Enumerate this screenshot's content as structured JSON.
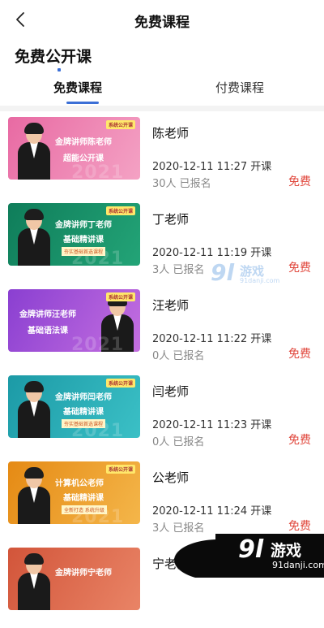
{
  "nav": {
    "title": "免费课程"
  },
  "section": {
    "title": "免费公开课"
  },
  "tabs": [
    {
      "label": "免费课程",
      "active": true
    },
    {
      "label": "付费课程",
      "active": false
    }
  ],
  "courses": [
    {
      "teacher": "陈老师",
      "time": "2020-12-11 11:27 开课",
      "enrolled": "30人 已报名",
      "price": "免费",
      "thumb": {
        "badge": "系统公开课",
        "line1": "金牌讲师陈老师",
        "line2": "超能公开课",
        "line3": "",
        "year": "2021",
        "bg": "#e86aa3",
        "bg2": "#f4a2c4"
      }
    },
    {
      "teacher": "丁老师",
      "time": "2020-12-11 11:19 开课",
      "enrolled": "3人 已报名",
      "price": "免费",
      "thumb": {
        "badge": "系统公开课",
        "line1": "金牌讲师丁老师",
        "line2": "基础精讲课",
        "line3": "夯实基础首选课程",
        "year": "2021",
        "bg": "#0f7d5a",
        "bg2": "#23a477"
      }
    },
    {
      "teacher": "汪老师",
      "time": "2020-12-11 11:22 开课",
      "enrolled": "0人 已报名",
      "price": "免费",
      "thumb": {
        "badge": "系统公开课",
        "line1": "金牌讲师汪老师",
        "line2": "基础语法课",
        "line3": "",
        "year": "2021",
        "bg": "#8a3fd1",
        "bg2": "#c46fe0"
      }
    },
    {
      "teacher": "闫老师",
      "time": "2020-12-11 11:23 开课",
      "enrolled": "0人 已报名",
      "price": "免费",
      "thumb": {
        "badge": "系统公开课",
        "line1": "金牌讲师闫老师",
        "line2": "基础精讲课",
        "line3": "夯实基础首选课程",
        "year": "2021",
        "bg": "#1c9aa6",
        "bg2": "#3bc0c6"
      }
    },
    {
      "teacher": "公老师",
      "time": "2020-12-11 11:24 开课",
      "enrolled": "3人 已报名",
      "price": "免费",
      "thumb": {
        "badge": "系统公开课",
        "line1": "计算机公老师",
        "line2": "基础精讲课",
        "line3": "全新打造 系统升级",
        "year": "2021",
        "bg": "#e58a14",
        "bg2": "#f4b64a"
      }
    },
    {
      "teacher": "宁老师",
      "time": "",
      "enrolled": "",
      "price": "",
      "thumb": {
        "badge": "",
        "line1": "金牌讲师宁老师",
        "line2": "",
        "line3": "",
        "year": "",
        "bg": "#d2553a",
        "bg2": "#e98466"
      }
    }
  ],
  "watermark": {
    "num": "9l",
    "text": "游戏",
    "sub": "91danji.com"
  },
  "logo": {
    "num": "9l",
    "text": "游戏",
    "sub": "91danji.com"
  }
}
